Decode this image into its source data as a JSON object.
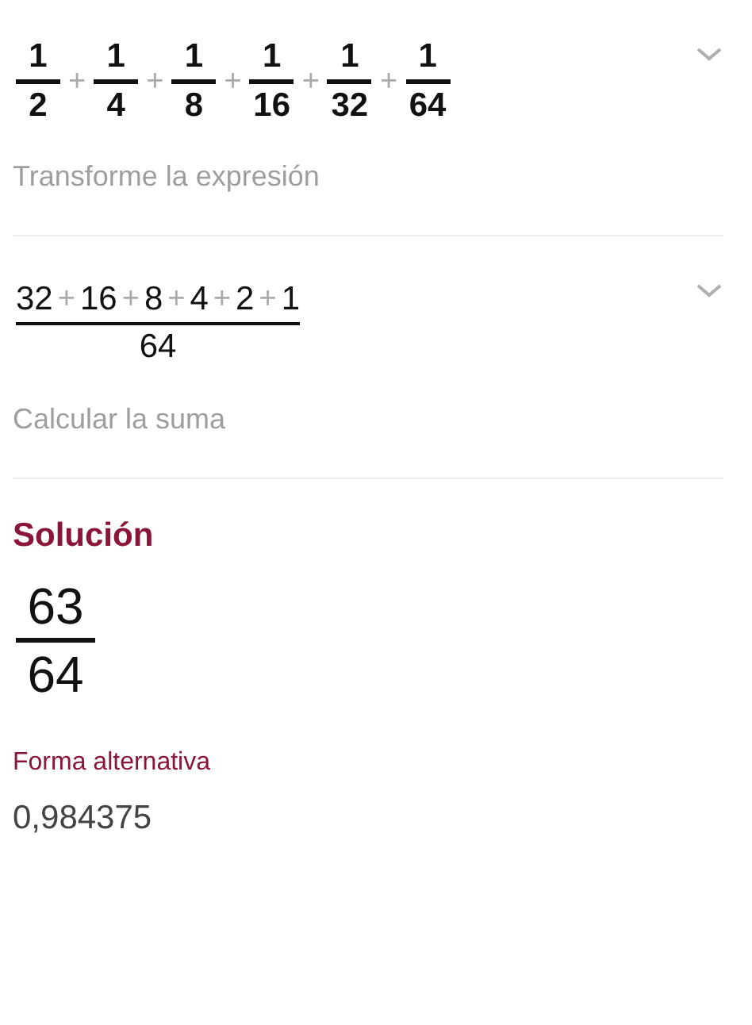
{
  "steps": [
    {
      "kind": "fraction_sum",
      "expanded": false,
      "caption": "Transforme la expresión",
      "items": [
        {
          "kind": "fraction",
          "numerator": "1",
          "denominator": "2"
        },
        {
          "kind": "operator",
          "text": "+"
        },
        {
          "kind": "fraction",
          "numerator": "1",
          "denominator": "4"
        },
        {
          "kind": "operator",
          "text": "+"
        },
        {
          "kind": "fraction",
          "numerator": "1",
          "denominator": "8"
        },
        {
          "kind": "operator",
          "text": "+"
        },
        {
          "kind": "fraction",
          "numerator": "1",
          "denominator": "16"
        },
        {
          "kind": "operator",
          "text": "+"
        },
        {
          "kind": "fraction",
          "numerator": "1",
          "denominator": "32"
        },
        {
          "kind": "operator",
          "text": "+"
        },
        {
          "kind": "fraction",
          "numerator": "1",
          "denominator": "64"
        }
      ]
    },
    {
      "kind": "sum_over",
      "expanded": false,
      "caption": "Calcular la suma",
      "denominator": "64",
      "items": [
        {
          "kind": "number",
          "text": "32"
        },
        {
          "kind": "operator",
          "text": "+"
        },
        {
          "kind": "number",
          "text": "16"
        },
        {
          "kind": "operator",
          "text": "+"
        },
        {
          "kind": "number",
          "text": "8"
        },
        {
          "kind": "operator",
          "text": "+"
        },
        {
          "kind": "number",
          "text": "4"
        },
        {
          "kind": "operator",
          "text": "+"
        },
        {
          "kind": "number",
          "text": "2"
        },
        {
          "kind": "operator",
          "text": "+"
        },
        {
          "kind": "number",
          "text": "1"
        }
      ]
    }
  ],
  "solution": {
    "title": "Solución",
    "numerator": "63",
    "denominator": "64",
    "alternative_label": "Forma alternativa",
    "alternative_value": "0,984375"
  }
}
